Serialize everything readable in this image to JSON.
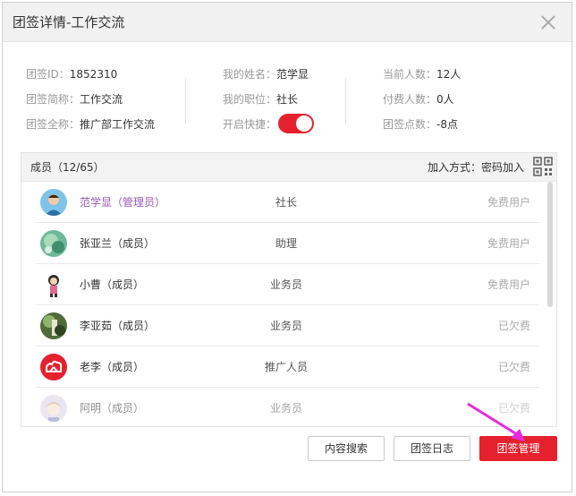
{
  "dialog": {
    "title": "团签详情-工作交流"
  },
  "info": {
    "col1": [
      {
        "label": "团签ID：",
        "value": "1852310"
      },
      {
        "label": "团签简称：",
        "value": "工作交流"
      },
      {
        "label": "团签全称：",
        "value": "推广部工作交流"
      }
    ],
    "col2": [
      {
        "label": "我的姓名：",
        "value": "范学显"
      },
      {
        "label": "我的职位：",
        "value": "社长"
      },
      {
        "label": "开启快捷：",
        "value": ""
      }
    ],
    "col3": [
      {
        "label": "当前人数：",
        "value": "12人"
      },
      {
        "label": "付费人数：",
        "value": "0人"
      },
      {
        "label": "团签点数：",
        "value": "-8点"
      }
    ],
    "quick_toggle_on": true
  },
  "members": {
    "title": "成员（12/65）",
    "join_method": "加入方式：密码加入",
    "rows": [
      {
        "name": "范学显（管理员）",
        "role": "社长",
        "status": "免费用户",
        "name_color": "#9b59b6"
      },
      {
        "name": "张亚兰（成员）",
        "role": "助理",
        "status": "免费用户"
      },
      {
        "name": "小曹（成员）",
        "role": "业务员",
        "status": "免费用户"
      },
      {
        "name": "李亚茹（成员）",
        "role": "业务员",
        "status": "已欠费"
      },
      {
        "name": "老李（成员）",
        "role": "推广人员",
        "status": "已欠费"
      },
      {
        "name": "阿明（成员）",
        "role": "业务员",
        "status": "已欠费"
      }
    ]
  },
  "buttons": {
    "content_search": "内容搜索",
    "group_log": "团签日志",
    "group_manage": "团签管理"
  },
  "colors": {
    "accent": "#e5212d",
    "arrow": "#e62ae0"
  }
}
